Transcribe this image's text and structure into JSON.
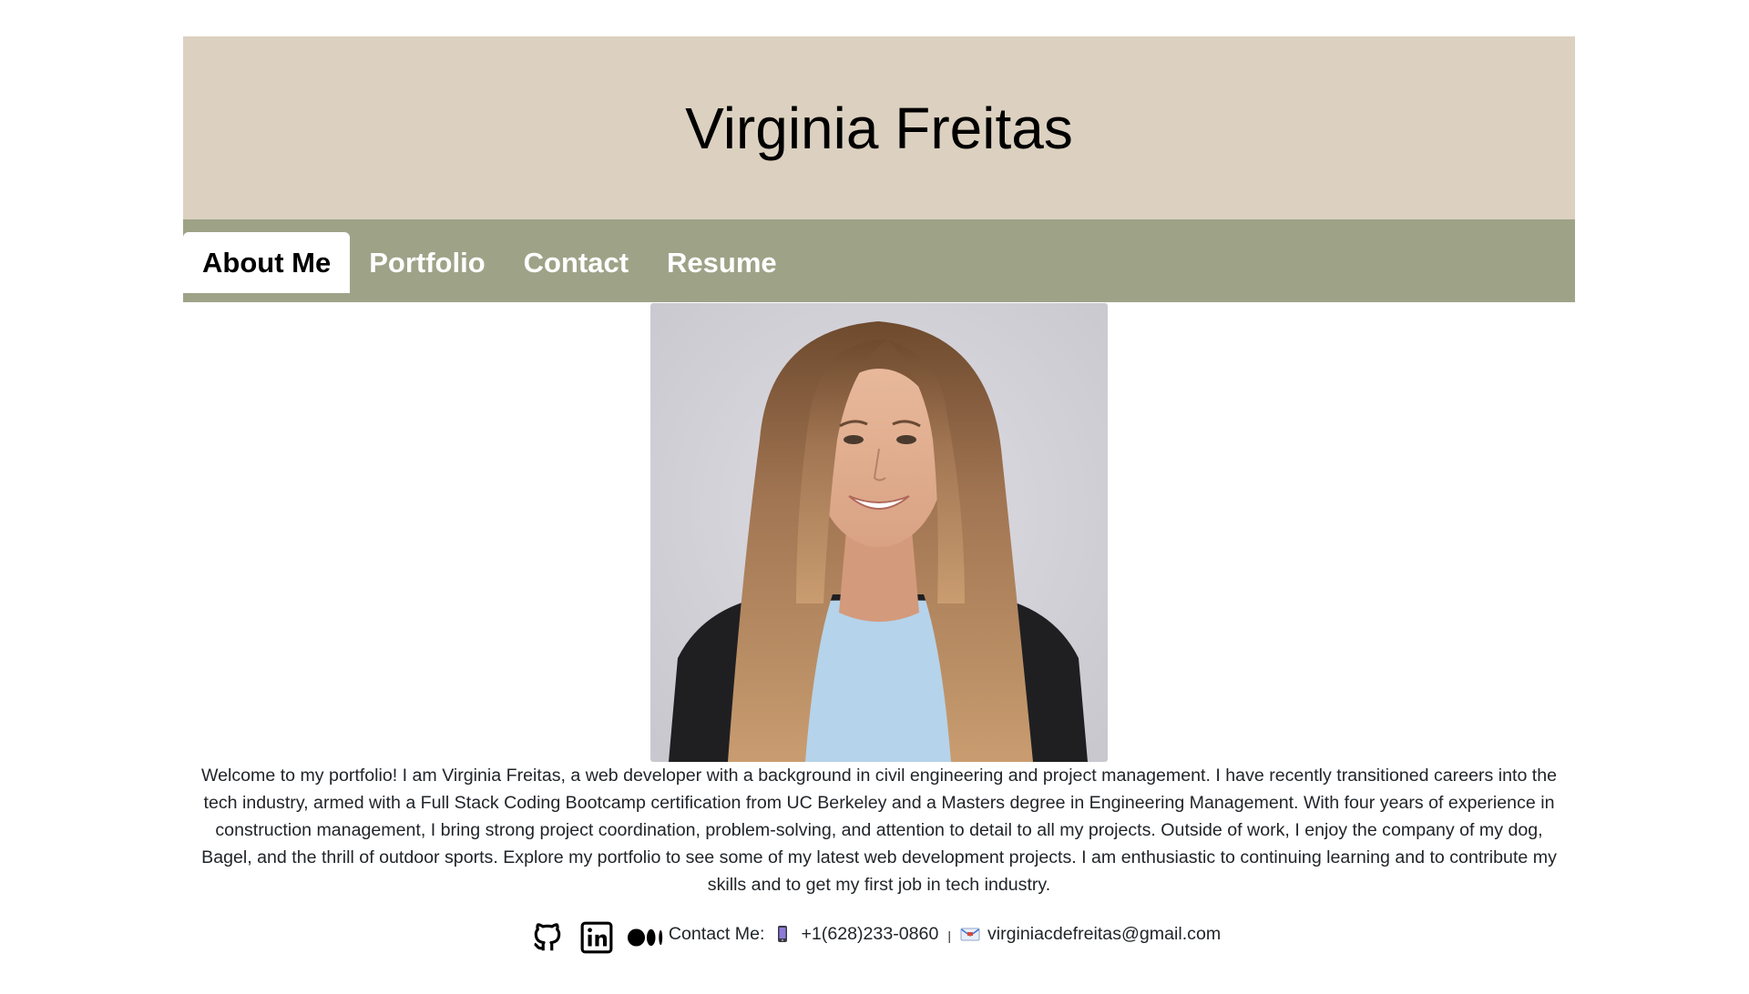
{
  "header": {
    "title": "Virginia Freitas",
    "background_color": "#dcd1c0"
  },
  "nav": {
    "background_color": "#9ea388",
    "tabs": [
      {
        "label": "About Me",
        "active": true
      },
      {
        "label": "Portfolio",
        "active": false
      },
      {
        "label": "Contact",
        "active": false
      },
      {
        "label": "Resume",
        "active": false
      }
    ]
  },
  "about": {
    "photo_icon": "profile-photo",
    "bio": "Welcome to my portfolio! I am Virginia Freitas, a web developer with a background in civil engineering and project management. I have recently transitioned careers into the tech industry, armed with a Full Stack Coding Bootcamp certification from UC Berkeley and a Masters degree in Engineering Management. With four years of experience in construction management, I bring strong project coordination, problem-solving, and attention to detail to all my projects. Outside of work, I enjoy the company of my dog, Bagel, and the thrill of outdoor sports. Explore my portfolio to see some of my latest web development projects. I am enthusiastic to continuing learning and to contribute my skills and to get my first job in tech industry."
  },
  "footer": {
    "social_icons": [
      "github-icon",
      "linkedin-icon",
      "medium-icon"
    ],
    "contact_label": "Contact Me:",
    "phone_icon": "mobile-phone-icon",
    "phone": "+1(628)233-0860",
    "separator": "|",
    "email_icon": "envelope-icon",
    "email": "virginiacdefreitas@gmail.com"
  }
}
